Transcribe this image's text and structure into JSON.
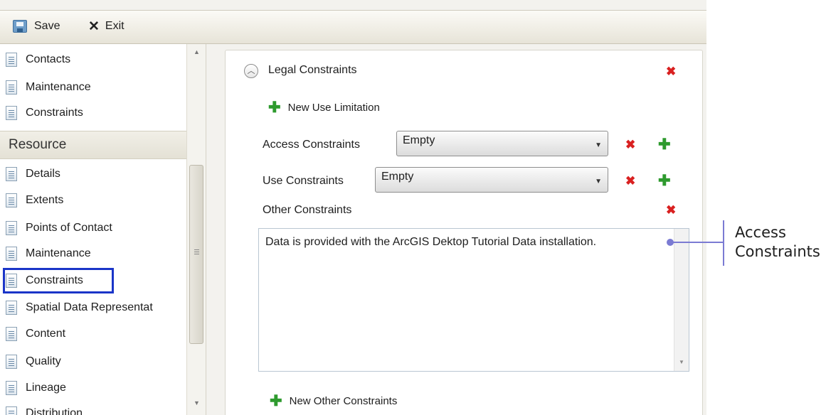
{
  "toolbar": {
    "save_label": "Save",
    "exit_label": "Exit"
  },
  "sidebar": {
    "items_top": [
      "Contacts",
      "Maintenance",
      "Constraints"
    ],
    "section_header": "Resource",
    "items_resource": [
      "Details",
      "Extents",
      "Points of Contact",
      "Maintenance",
      "Constraints",
      "Spatial Data Representat",
      "Content",
      "Quality",
      "Lineage",
      "Distribution"
    ],
    "selected": "Constraints"
  },
  "panel": {
    "title": "Legal Constraints",
    "new_use_limitation": "New Use Limitation",
    "access_constraints": {
      "label": "Access Constraints",
      "value": "Empty"
    },
    "use_constraints": {
      "label": "Use Constraints",
      "value": "Empty"
    },
    "other_constraints": {
      "label": "Other Constraints",
      "value": "Data is provided with the ArcGIS Dektop Tutorial Data installation."
    },
    "new_other_constraints": "New Other Constraints"
  },
  "callout": {
    "line1": "Access",
    "line2": "Constraints"
  },
  "colors": {
    "selection_border": "#1a35c8",
    "delete": "#d92020",
    "add": "#2e9a2e",
    "callout": "#7b7bd3"
  }
}
